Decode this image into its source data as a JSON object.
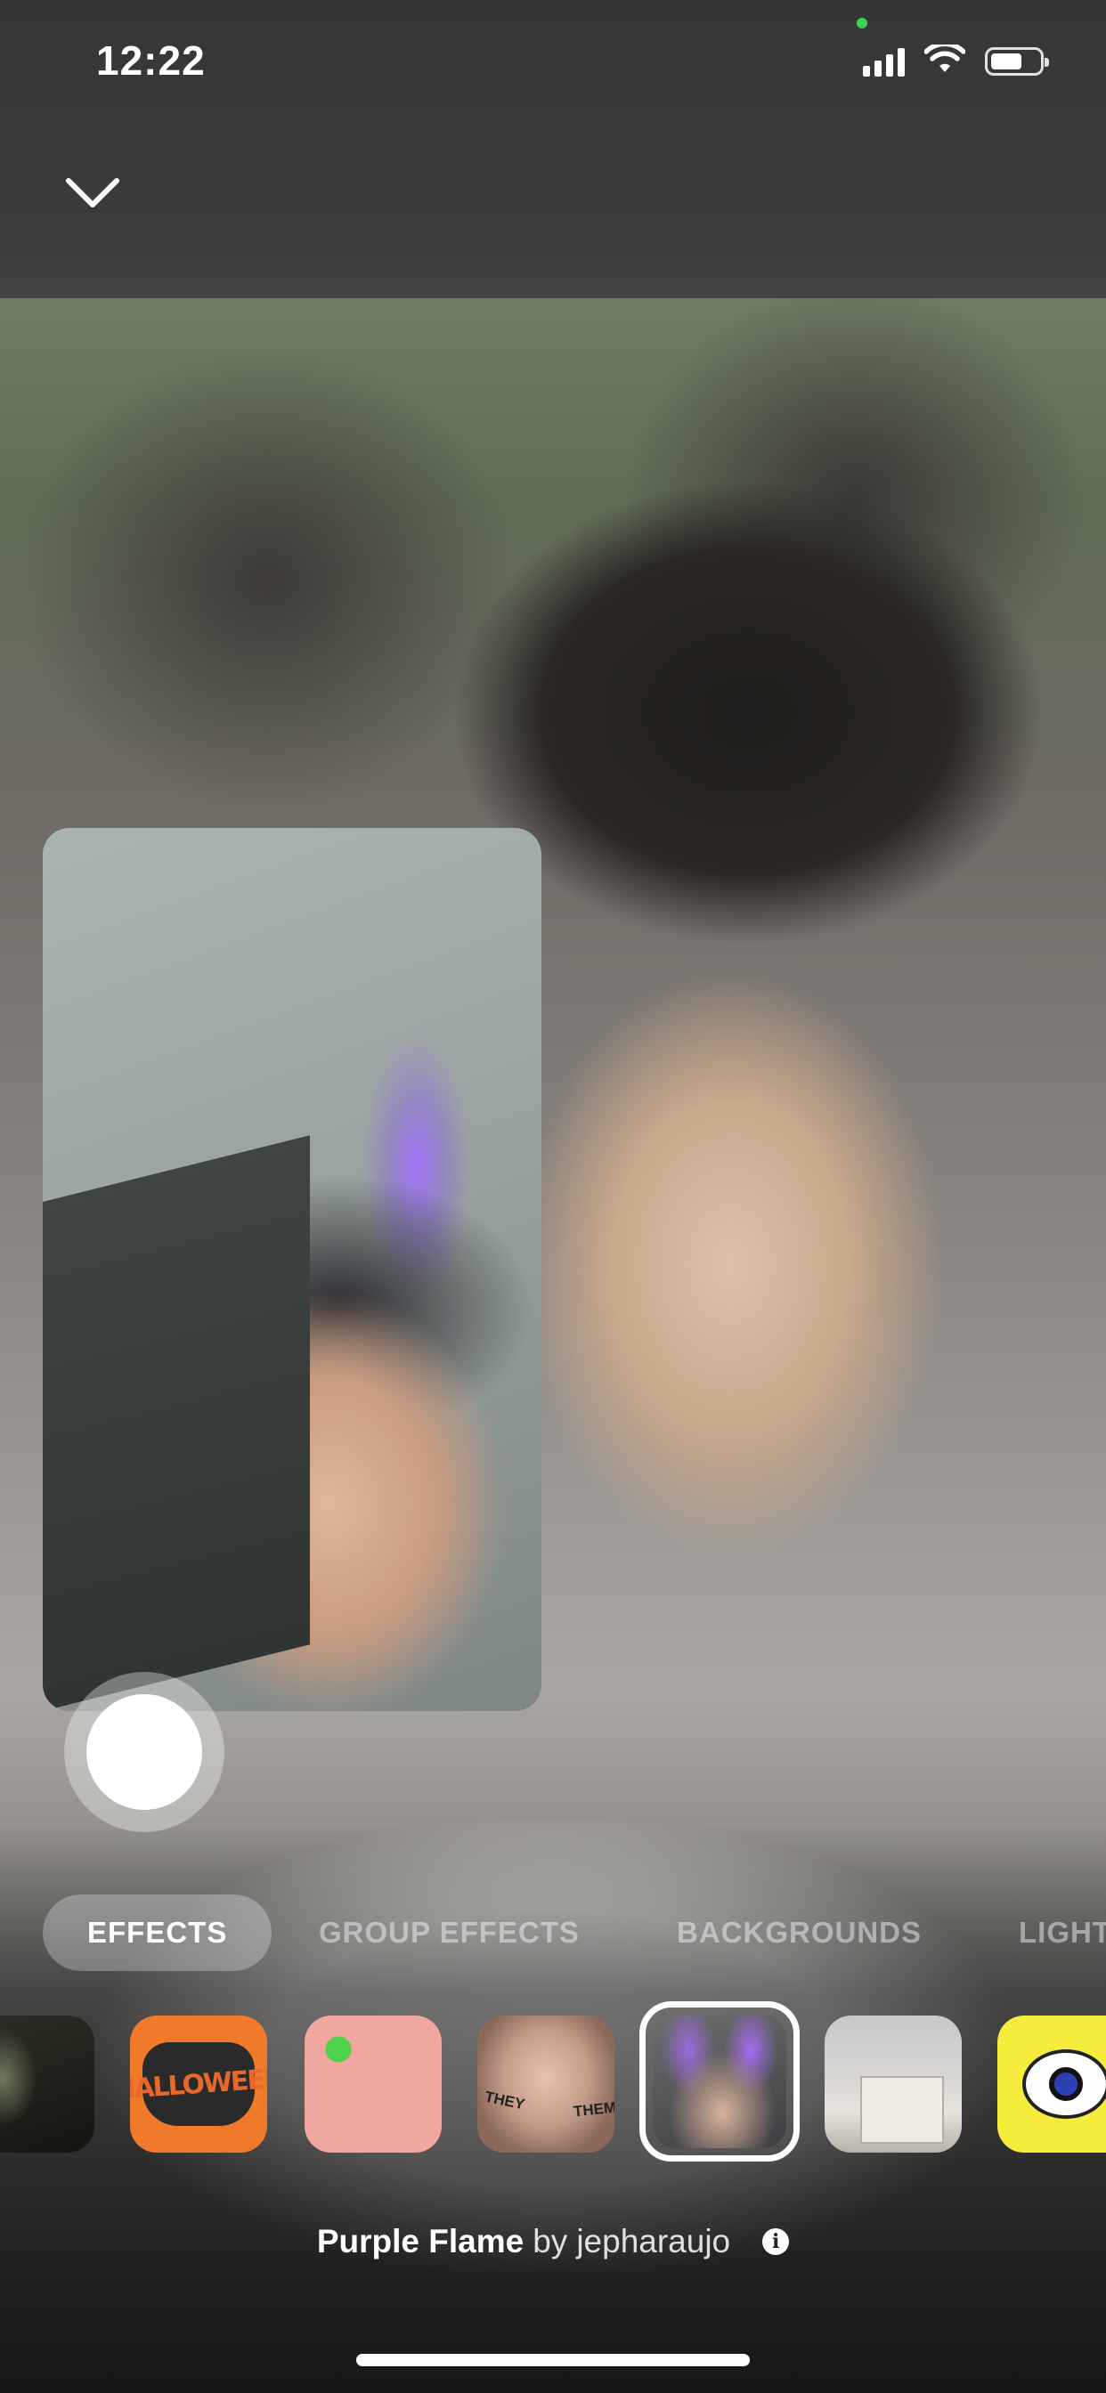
{
  "status_bar": {
    "time": "12:22"
  },
  "tabs": [
    {
      "label": "EFFECTS",
      "active": true
    },
    {
      "label": "GROUP EFFECTS",
      "active": false
    },
    {
      "label": "BACKGROUNDS",
      "active": false
    },
    {
      "label": "LIGHT",
      "active": false
    }
  ],
  "effects": [
    {
      "name": "zombie-effect"
    },
    {
      "name": "halloween-mask-effect",
      "text": "HALLOWEEN"
    },
    {
      "name": "green-pattern-effect"
    },
    {
      "name": "they-them-effect",
      "text_left": "THEY",
      "text_right": "THEM"
    },
    {
      "name": "purple-flame-effect",
      "selected": true
    },
    {
      "name": "building-effect"
    },
    {
      "name": "eye-effect"
    }
  ],
  "effect_info": {
    "name": "Purple Flame",
    "by_prefix": "by",
    "author": "jepharaujo"
  },
  "colors": {
    "active_tab_bg": "#474747",
    "text": "#ffffff",
    "mic_indicator": "#3cd35a"
  },
  "icons": {
    "collapse": "chevron-down-icon",
    "signal": "cellular-signal-icon",
    "wifi": "wifi-icon",
    "battery": "battery-icon",
    "info": "info-icon"
  }
}
